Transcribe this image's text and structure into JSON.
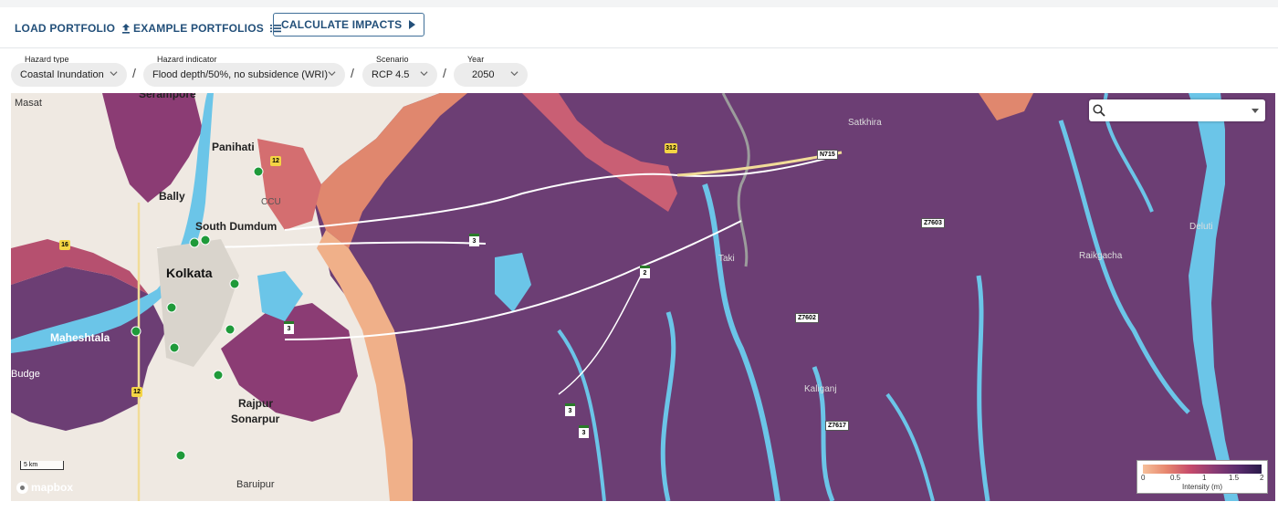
{
  "toolbar": {
    "load_portfolio": "LOAD PORTFOLIO",
    "example_portfolios": "EXAMPLE PORTFOLIOS",
    "calculate_impacts": "CALCULATE IMPACTS"
  },
  "filters": {
    "hazard_type": {
      "label": "Hazard type",
      "value": "Coastal Inundation"
    },
    "hazard_indicator": {
      "label": "Hazard indicator",
      "value": "Flood depth/50%, no subsidence (WRI)"
    },
    "scenario": {
      "label": "Scenario",
      "value": "RCP 4.5"
    },
    "year": {
      "label": "Year",
      "value": "2050"
    },
    "separator": "/"
  },
  "map": {
    "places": {
      "masat": "Masat",
      "serampore": "Serampore",
      "panihati": "Panihati",
      "bally": "Bally",
      "ccu": "CCU",
      "south_dumdum": "South Dumdum",
      "kolkata": "Kolkata",
      "maheshtala": "Maheshtala",
      "budge": "Budge",
      "rajpur": "Rajpur",
      "sonarpur": "Sonarpur",
      "baruipur": "Baruipur",
      "satkhira": "Satkhira",
      "taki": "Taki",
      "kaliganj": "Kaliganj",
      "raikgacha": "Raikgacha",
      "deluti": "Deluti"
    },
    "routes": {
      "r312": "312",
      "r12a": "12",
      "r16": "16",
      "r12b": "12",
      "r3a": "3",
      "r3b": "3",
      "r3c": "3",
      "r3d": "3",
      "r2": "2",
      "n715": "N715",
      "z7603": "Z7603",
      "z7602": "Z7602",
      "z7617": "Z7617"
    },
    "scale_label": "5 km",
    "attribution": "mapbox",
    "colors": {
      "land": "#efe9e2",
      "flood_deep": "#6c3e74",
      "water": "#6bc5e8",
      "marker": "#1f9a3a"
    }
  },
  "legend": {
    "ticks": [
      "0",
      "0.5",
      "1",
      "1.5",
      "2"
    ],
    "title": "Intensity (m)"
  }
}
